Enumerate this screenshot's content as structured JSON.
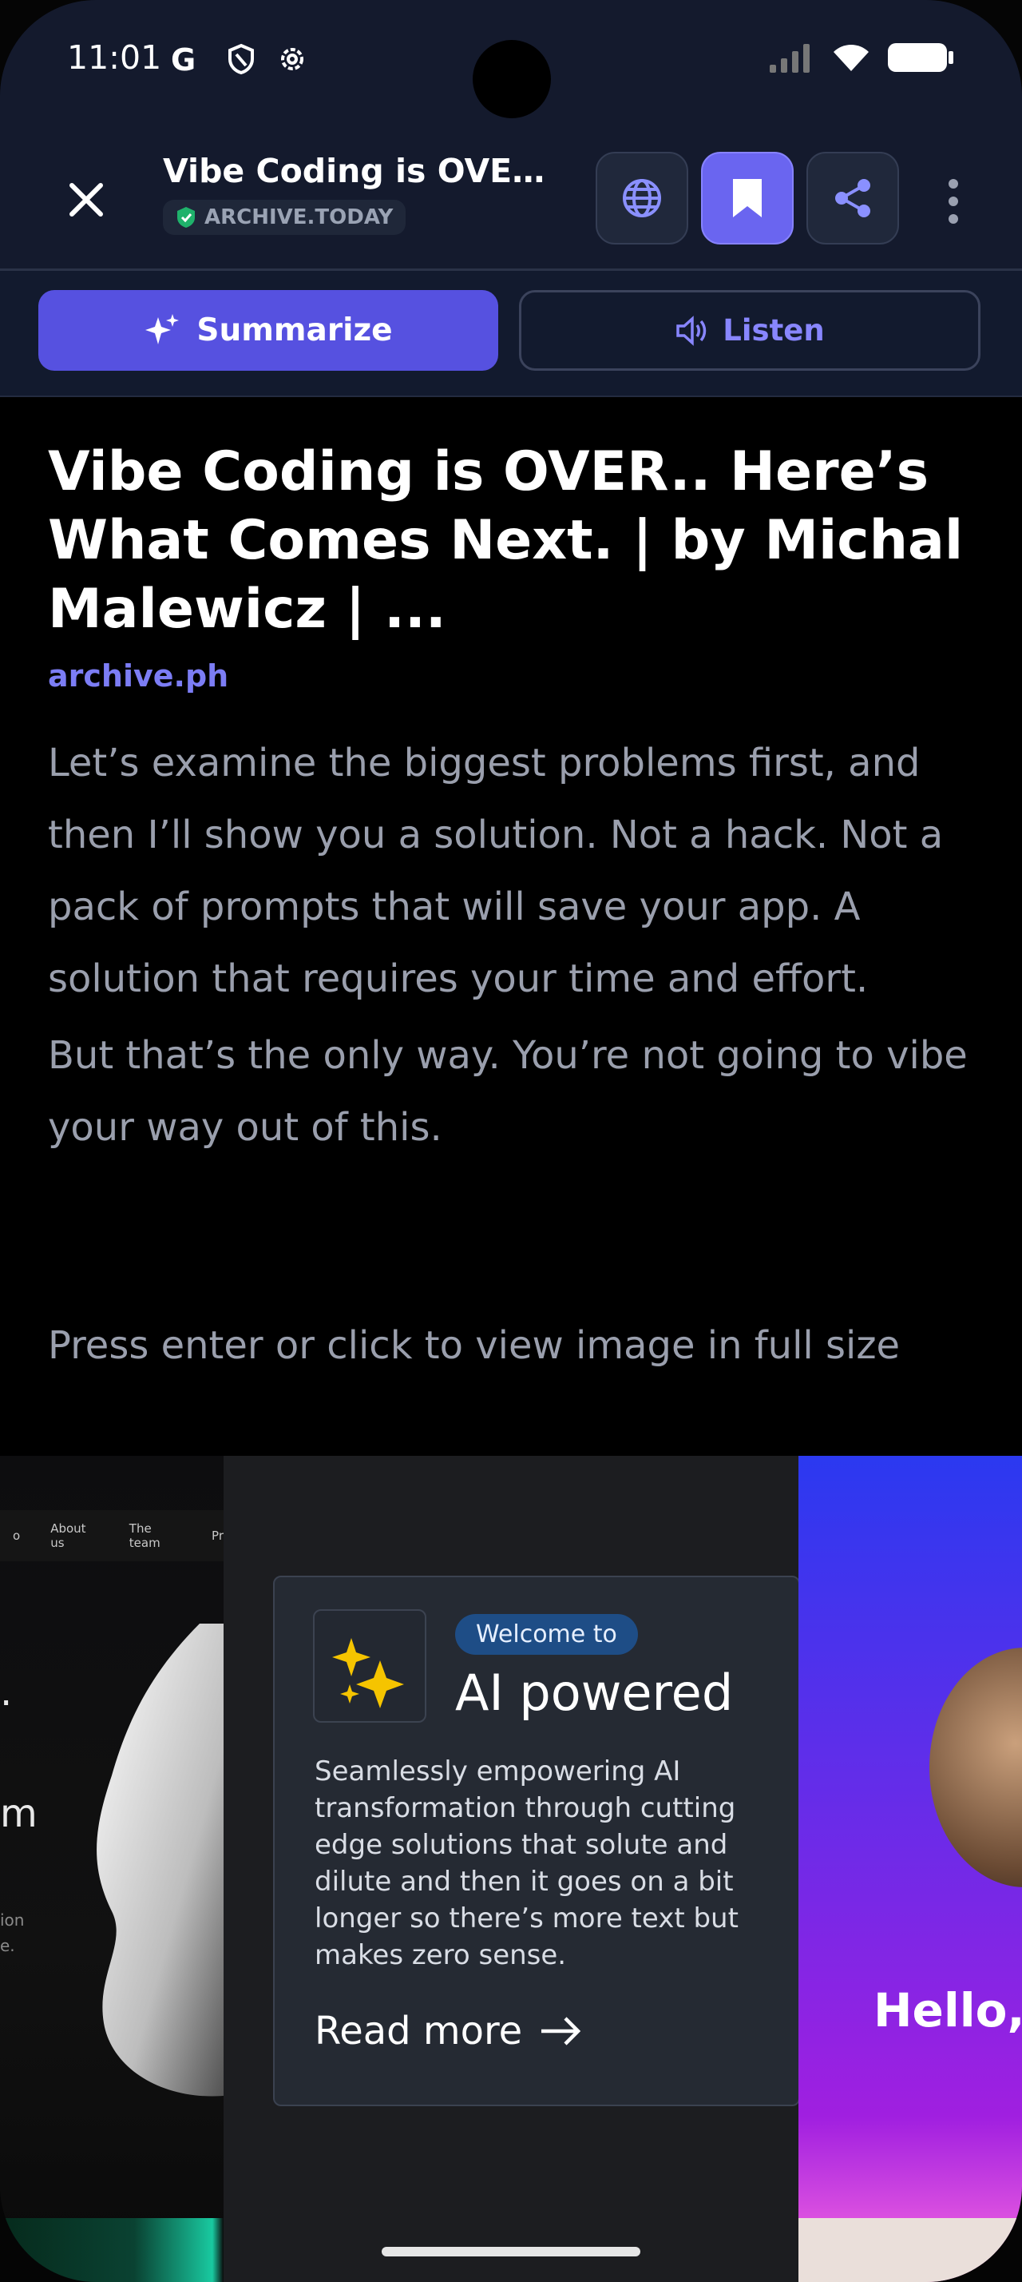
{
  "status_bar": {
    "time": "11:01",
    "left_icons": [
      "google-icon",
      "shield-icon",
      "settings-icon"
    ],
    "right_icons": [
      "signal-icon",
      "wifi-icon",
      "battery-icon"
    ]
  },
  "header": {
    "title": "Vibe Coding is OVER.. ...",
    "source_badge": "ARCHIVE.TODAY",
    "buttons": [
      "globe-icon",
      "bookmark-icon",
      "share-icon",
      "more-icon"
    ]
  },
  "actions": {
    "summarize_label": "Summarize",
    "listen_label": "Listen"
  },
  "article": {
    "title": "Vibe Coding is OVER.. Here’s What Comes Next. | by Michal Malewicz | ...",
    "source": "archive.ph",
    "paragraphs": [
      "Let’s examine the biggest problems first, and then I’ll show you a solution. Not a hack. Not a pack of prompts that will save your app. A solution that requires your time and effort.",
      "But that’s the only way. You’re not going to vibe your way out of this."
    ],
    "image_hint": "Press enter or click to view image in full size"
  },
  "hero_image": {
    "left_nav": [
      "o",
      "About us",
      "The team",
      "Pr"
    ],
    "left_fragments": [
      ".",
      "m",
      "ion",
      "e."
    ],
    "card": {
      "pill": "Welcome to",
      "heading": "AI powered",
      "body": "Seamlessly empowering AI transformation through cutting edge solutions that solute and dilute and then it goes on a bit longer so there’s more text but makes zero sense.",
      "link": "Read more"
    },
    "right_text": "Hello,"
  },
  "colors": {
    "accent": "#5651e0",
    "toolbar": "#141a2d",
    "link": "#7c7df5",
    "body_text": "#9a9fad"
  }
}
